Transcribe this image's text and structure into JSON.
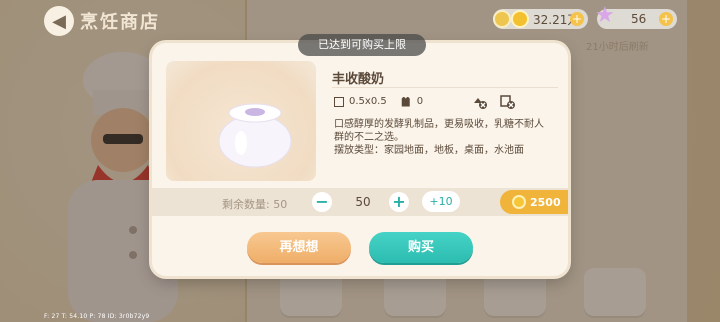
{
  "header": {
    "title": "烹饪商店",
    "back_icon": "back-arrow-icon"
  },
  "currency": {
    "coins": "32.21万",
    "stars": "56"
  },
  "toast": "已达到可购买上限",
  "background": {
    "refresh_text": "21小时后刷新"
  },
  "modal": {
    "item_name": "丰收酸奶",
    "size_value": "0.5x0.5",
    "count_value": "0",
    "description_lines": [
      "口感醇厚的发酵乳制品，更易吸收，乳糖不耐人",
      "群的不二之选。",
      "摆放类型：家园地面，地板，桌面，水池面"
    ],
    "quantity_label": "剩余数量: 50",
    "quantity_value": "50",
    "plus10_label": "+10",
    "price": "2500",
    "cancel_label": "再想想",
    "buy_label": "购买"
  },
  "debug": "F: 27   T: 54.10   P: 78   ID: 3r0b72y9",
  "colors": {
    "accent_teal": "#2cbcb0",
    "accent_orange": "#efae68",
    "gold": "#f0b43a"
  }
}
